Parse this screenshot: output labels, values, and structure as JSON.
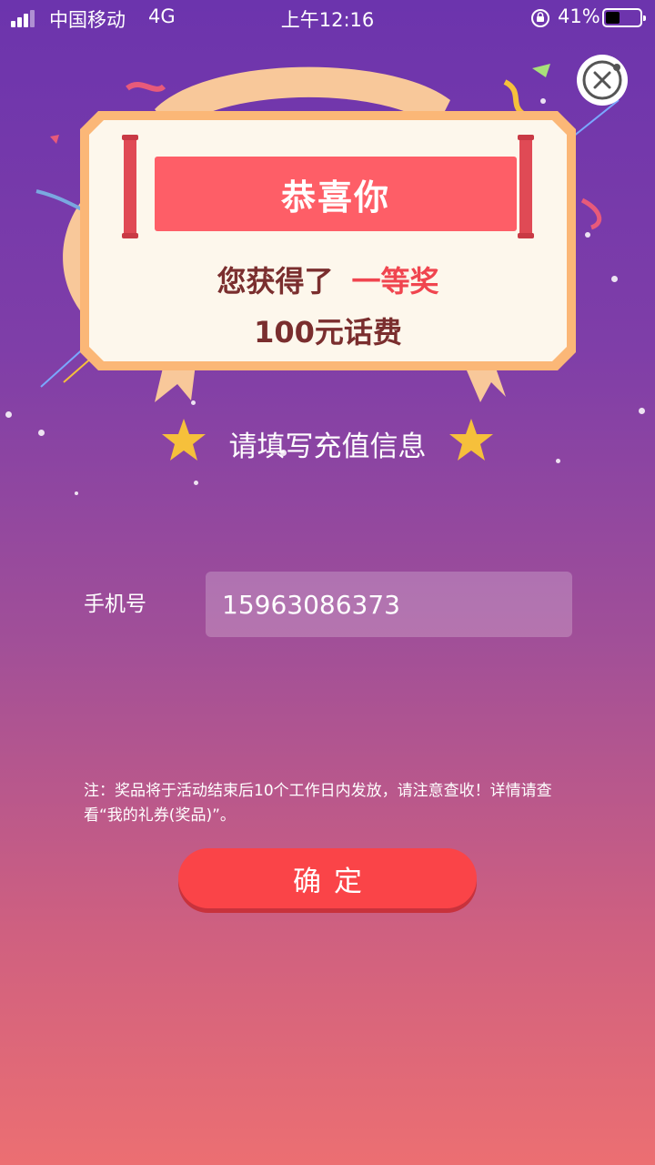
{
  "status_bar": {
    "carrier": "中国移动",
    "network": "4G",
    "time": "上午12:16",
    "battery_percent": "41%",
    "battery_level": 0.41,
    "icons": [
      "signal-icon",
      "orientation-lock-icon",
      "battery-icon"
    ]
  },
  "popup": {
    "close_icon": "close-circle-icon",
    "title": "恭喜你",
    "prize_prefix": "您获得了",
    "prize_name": "一等奖",
    "prize_detail": "100元话费"
  },
  "form": {
    "subtitle": "请填写充值信息",
    "phone_label": "手机号",
    "phone_value": "15963086373",
    "note": "注：奖品将于活动结束后10个工作日内发放，请注意查收！详情请查看“我的礼券(奖品)”。",
    "confirm_label": "确定"
  },
  "colors": {
    "accent_red": "#fa4448",
    "banner_red": "#fe5e67",
    "prize_highlight": "#f0454f",
    "card_bg": "#fdf7ec",
    "card_border": "#fbb777",
    "star": "#f6c03b"
  }
}
